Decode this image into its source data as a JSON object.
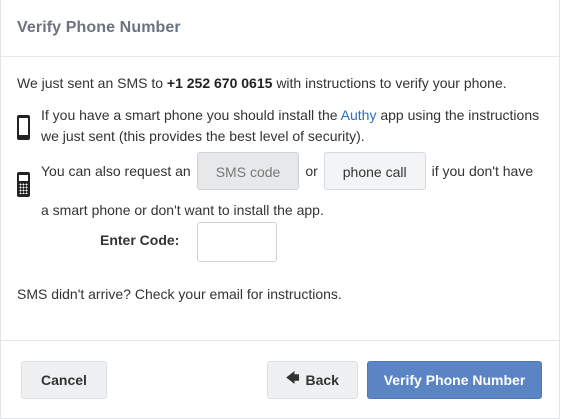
{
  "dialog": {
    "title": "Verify Phone Number"
  },
  "intro": {
    "prefix": "We just sent an SMS to",
    "phone_number": "+1 252 670 0615",
    "suffix": "with instructions to verify your phone."
  },
  "smartphone": {
    "icon": "smartphone-icon",
    "text_before": "If you have a smart phone you should install the",
    "link": "Authy",
    "text_after": "app using the instructions we just sent (this provides the best level of security)."
  },
  "featurephone": {
    "icon": "featurephone-icon",
    "text_before": "You can also request an",
    "sms_button": "SMS code",
    "or": "or",
    "call_button": "phone call",
    "text_after": "if you don't have",
    "line2": "a smart phone or don't want to install the app."
  },
  "code": {
    "label": "Enter Code:",
    "value": "",
    "placeholder": ""
  },
  "sms_help": "SMS didn't arrive? Check your email for instructions.",
  "footer": {
    "cancel": "Cancel",
    "back": "Back",
    "back_icon": "arrow-left-icon",
    "verify": "Verify Phone Number"
  },
  "colors": {
    "primary": "#5b84c4",
    "link": "#2f6fb5"
  }
}
